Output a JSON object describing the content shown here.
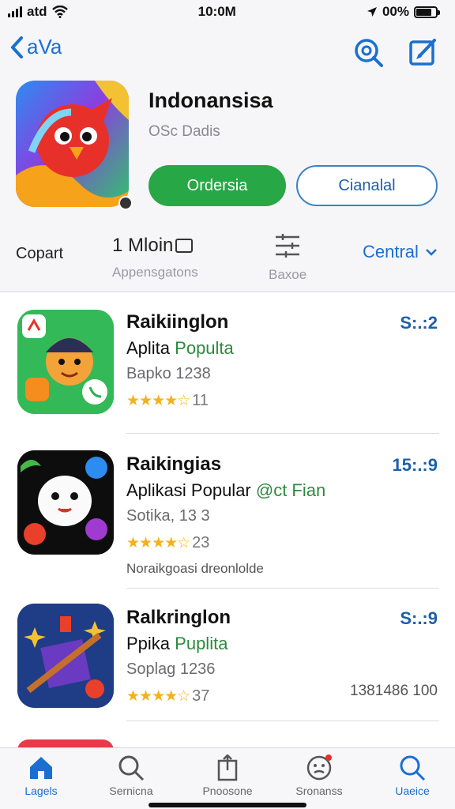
{
  "status": {
    "carrier": "atd",
    "time": "10:0M",
    "battery": "00%",
    "battery_level": 0.8
  },
  "nav": {
    "back_label": "aVa"
  },
  "app": {
    "title": "Indonansisa",
    "subtitle": "OSc Dadis",
    "primary_button": "Ordersia",
    "secondary_button": "Cianalal"
  },
  "meta": {
    "item1_label": "Copart",
    "item2_label": "1 Mloin",
    "item2_sub": "Appensgatons",
    "item3_sub": "Baxoe",
    "item4_label": "Central"
  },
  "list": [
    {
      "title": "Raikiinglon",
      "sub_text": "Aplita ",
      "sub_tag": "Populta",
      "meta": "Bapko 1238",
      "stars": "★★★★☆",
      "rating_count": "11",
      "price": "S:.:2",
      "extra": "",
      "extra_right": ""
    },
    {
      "title": "Raikingias",
      "sub_text": "Aplikasi Popular ",
      "sub_tag": "@ct Fian",
      "meta": "Sotika, 13 3",
      "stars": "★★★★☆",
      "rating_count": "23",
      "price": "15:.:9",
      "extra": "Noraikgoasi dreonlolde",
      "extra_right": ""
    },
    {
      "title": "Ralkringlon",
      "sub_text": "Ppika ",
      "sub_tag": "Puplita",
      "meta": "Soplag 1236",
      "stars": "★★★★☆",
      "rating_count": "37",
      "price": "S:.:9",
      "extra": "",
      "extra_right": "1381486 100"
    }
  ],
  "tabs": [
    {
      "label": "Lagels",
      "icon": "home-icon"
    },
    {
      "label": "Sernicna",
      "icon": "search-icon"
    },
    {
      "label": "Pnoosone",
      "icon": "share-icon"
    },
    {
      "label": "Sronanss",
      "icon": "face-icon"
    },
    {
      "label": "Uaeice",
      "icon": "search-icon"
    }
  ],
  "colors": {
    "accent": "#1a6fd1",
    "primary_green": "#27a745",
    "star": "#f3b21a"
  }
}
